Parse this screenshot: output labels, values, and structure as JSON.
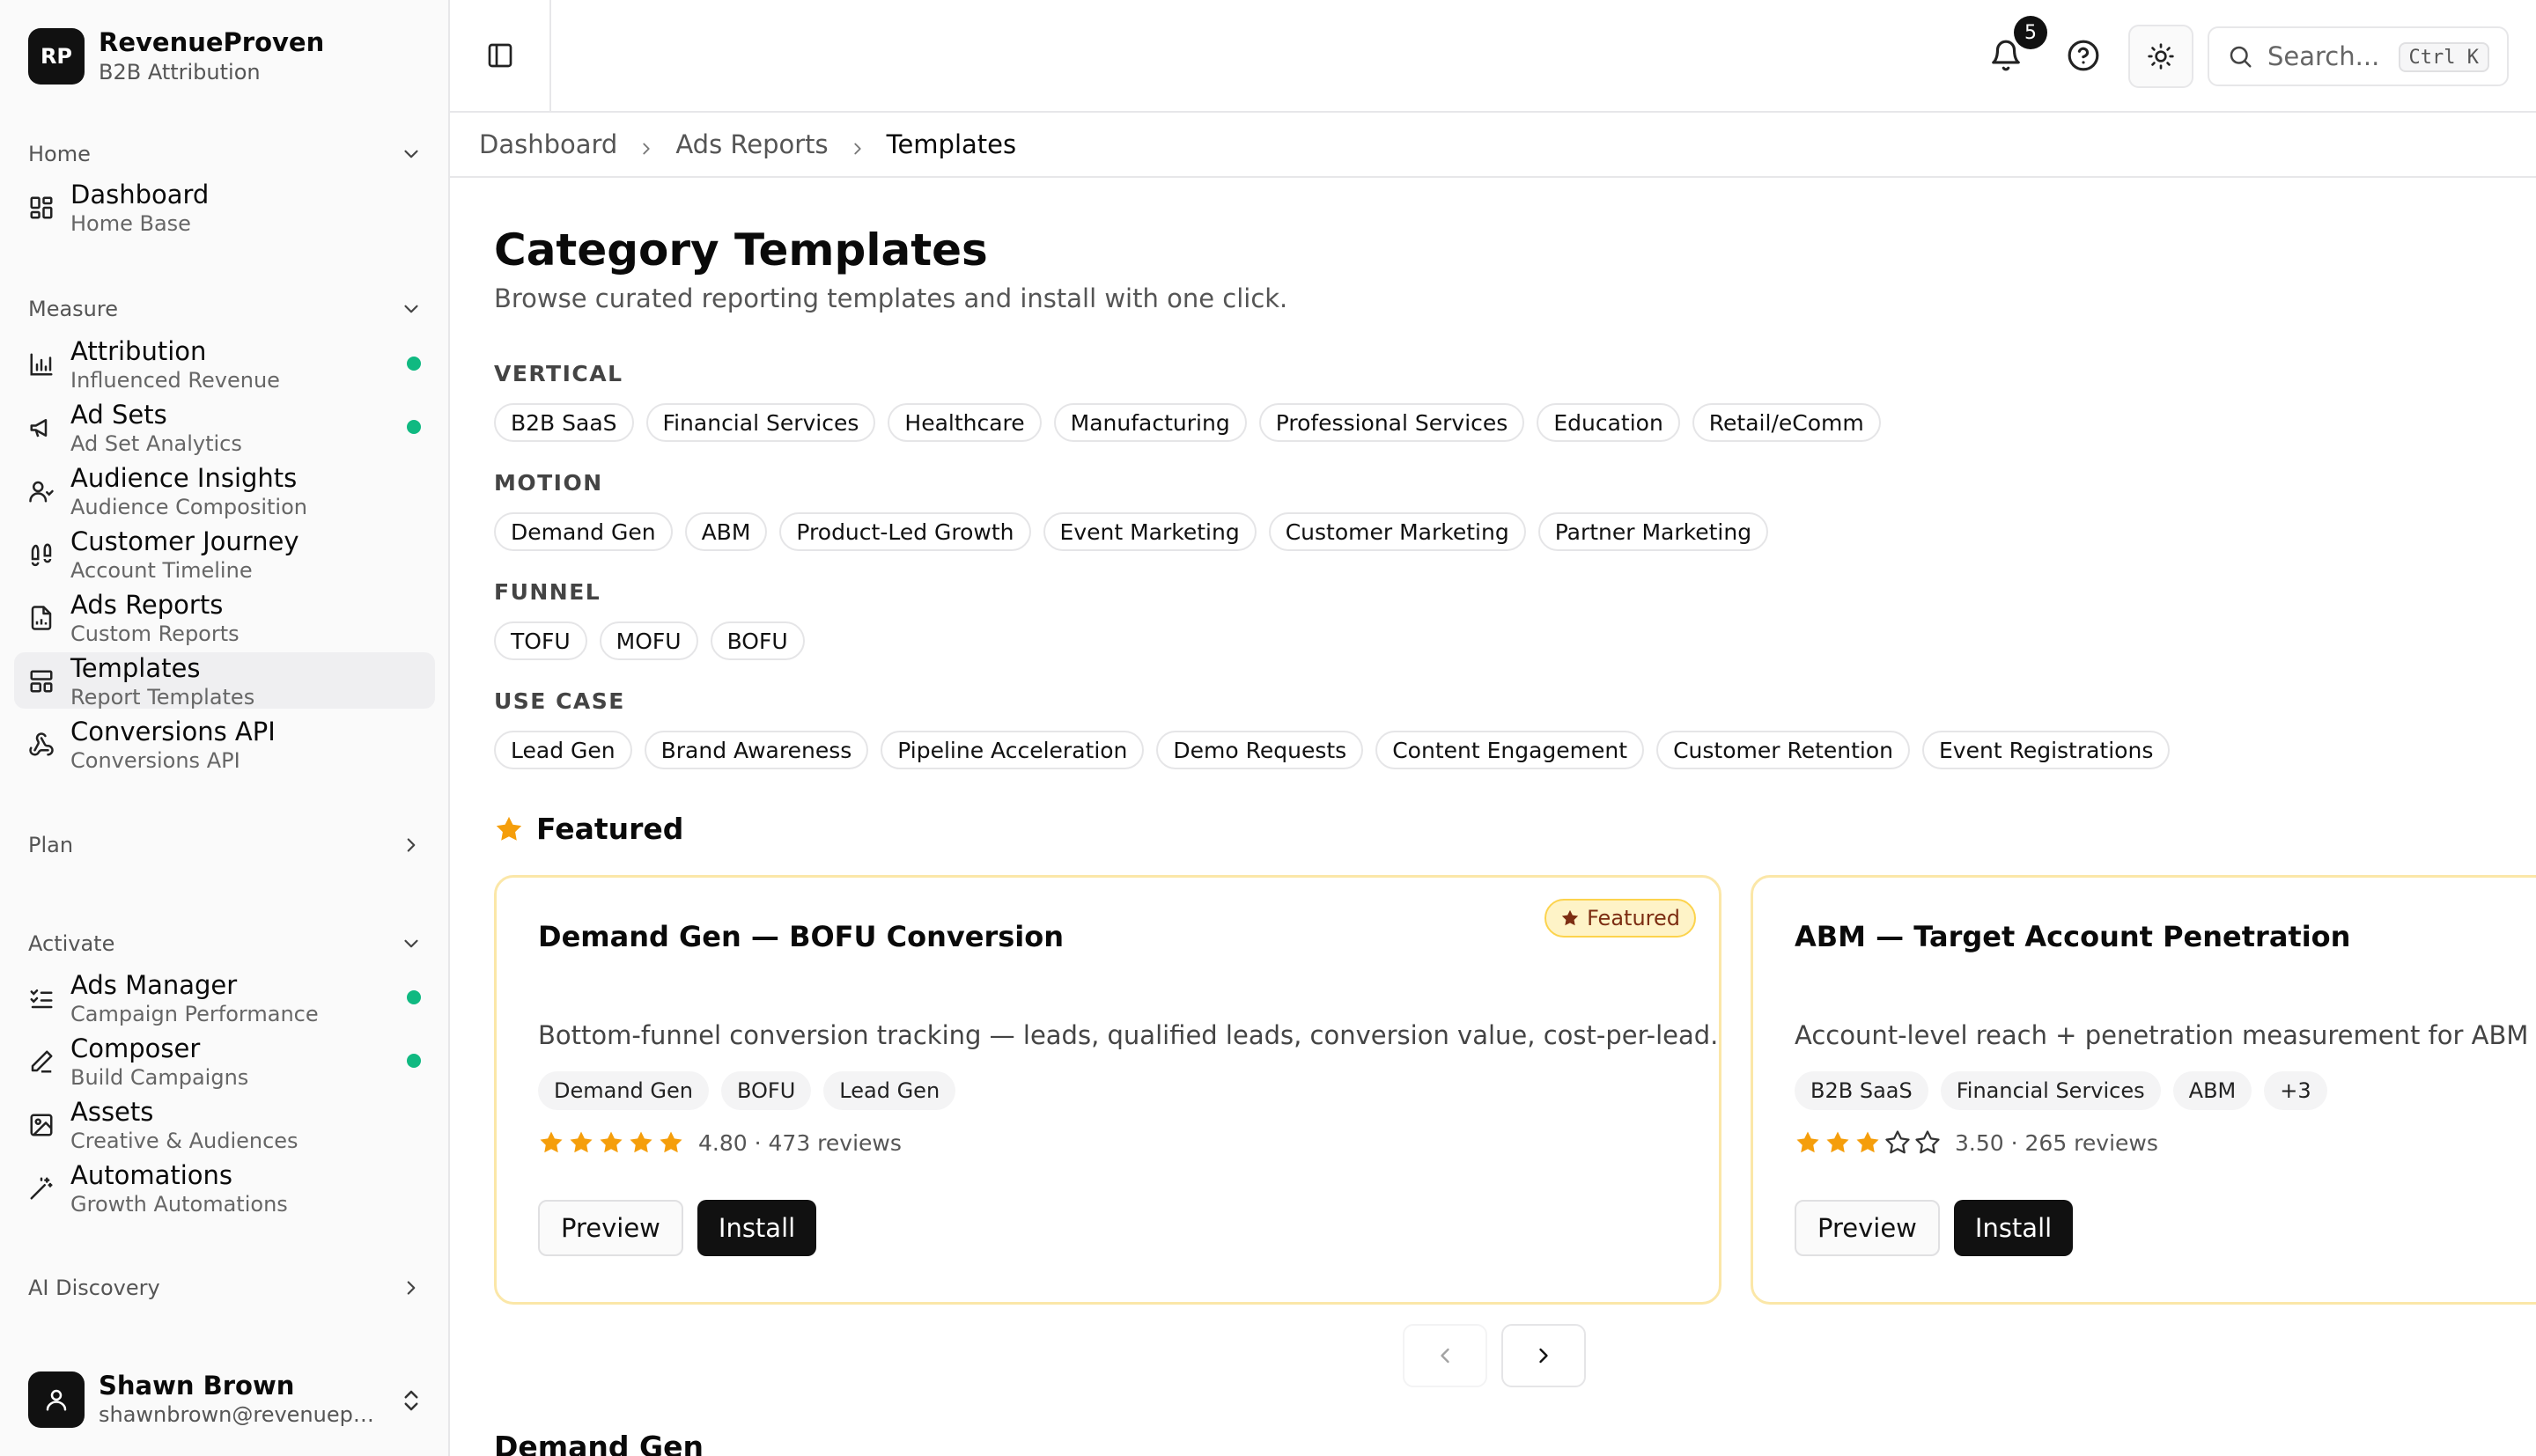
{
  "brand": {
    "logo": "RP",
    "name": "RevenueProven",
    "subtitle": "B2B Attribution"
  },
  "sidebar": {
    "groups": [
      {
        "label": "Home",
        "state": "expanded"
      },
      {
        "label": "Measure",
        "state": "expanded"
      },
      {
        "label": "Plan",
        "state": "collapsed"
      },
      {
        "label": "Activate",
        "state": "expanded"
      },
      {
        "label": "AI Discovery",
        "state": "collapsed"
      }
    ],
    "items": [
      {
        "title": "Dashboard",
        "subtitle": "Home Base",
        "icon": "grid-icon",
        "dot": false
      },
      {
        "title": "Attribution",
        "subtitle": "Influenced Revenue",
        "icon": "bar-chart-icon",
        "dot": true
      },
      {
        "title": "Ad Sets",
        "subtitle": "Ad Set Analytics",
        "icon": "megaphone-icon",
        "dot": true
      },
      {
        "title": "Audience Insights",
        "subtitle": "Audience Composition",
        "icon": "users-icon",
        "dot": false
      },
      {
        "title": "Customer Journey",
        "subtitle": "Account Timeline",
        "icon": "footprints-icon",
        "dot": false
      },
      {
        "title": "Ads Reports",
        "subtitle": "Custom Reports",
        "icon": "report-icon",
        "dot": false
      },
      {
        "title": "Templates",
        "subtitle": "Report Templates",
        "icon": "templates-icon",
        "dot": false,
        "active": true
      },
      {
        "title": "Conversions API",
        "subtitle": "Conversions API",
        "icon": "webhook-icon",
        "dot": false
      },
      {
        "title": "Ads Manager",
        "subtitle": "Campaign Performance",
        "icon": "list-check-icon",
        "dot": true
      },
      {
        "title": "Composer",
        "subtitle": "Build Campaigns",
        "icon": "pencil-icon",
        "dot": true
      },
      {
        "title": "Assets",
        "subtitle": "Creative & Audiences",
        "icon": "image-icon",
        "dot": false
      },
      {
        "title": "Automations",
        "subtitle": "Growth Automations",
        "icon": "wand-icon",
        "dot": false
      }
    ],
    "status_color": "#10b981"
  },
  "user": {
    "name": "Shawn Brown",
    "email": "shawnbrown@revenueproven.com"
  },
  "topbar": {
    "notifications_count": "5",
    "search_placeholder": "Search...",
    "search_shortcut": "Ctrl K"
  },
  "breadcrumb": [
    "Dashboard",
    "Ads Reports",
    "Templates"
  ],
  "page": {
    "title": "Category Templates",
    "subtitle": "Browse curated reporting templates and install with one click."
  },
  "facets": [
    {
      "label": "VERTICAL",
      "chips": [
        "B2B SaaS",
        "Financial Services",
        "Healthcare",
        "Manufacturing",
        "Professional Services",
        "Education",
        "Retail/eComm"
      ]
    },
    {
      "label": "MOTION",
      "chips": [
        "Demand Gen",
        "ABM",
        "Product-Led Growth",
        "Event Marketing",
        "Customer Marketing",
        "Partner Marketing"
      ]
    },
    {
      "label": "FUNNEL",
      "chips": [
        "TOFU",
        "MOFU",
        "BOFU"
      ]
    },
    {
      "label": "USE CASE",
      "chips": [
        "Lead Gen",
        "Brand Awareness",
        "Pipeline Acceleration",
        "Demo Requests",
        "Content Engagement",
        "Customer Retention",
        "Event Registrations"
      ]
    }
  ],
  "featured": {
    "heading": "Featured",
    "accent_color": "#f59e0b",
    "cards": [
      {
        "title": "Demand Gen — BOFU Conversion",
        "badge": "Featured",
        "description": "Bottom-funnel conversion tracking — leads, qualified leads, conversion value, cost-per-lead.",
        "tags": [
          "Demand Gen",
          "BOFU",
          "Lead Gen"
        ],
        "rating": 4.8,
        "rating_text": "4.80 · 473 reviews",
        "preview_label": "Preview",
        "install_label": "Install"
      },
      {
        "title": "ABM — Target Account Penetration",
        "badge": "",
        "description": "Account-level reach + penetration measurement for ABM programs.",
        "tags": [
          "B2B SaaS",
          "Financial Services",
          "ABM",
          "+3"
        ],
        "rating": 3.5,
        "rating_text": "3.50 · 265 reviews",
        "preview_label": "Preview",
        "install_label": "Install"
      }
    ]
  },
  "next_section": "Demand Gen"
}
